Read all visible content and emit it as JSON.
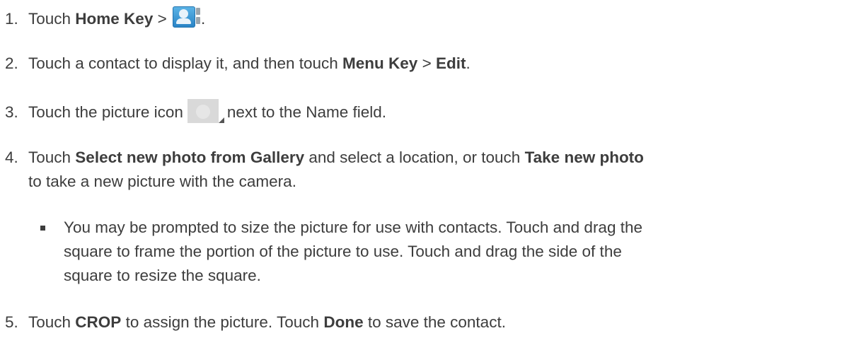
{
  "steps": [
    {
      "number": "1.",
      "text_before": "Touch ",
      "bold1": "Home Key",
      "text_mid": " > ",
      "icon": "contacts-app-icon",
      "text_after": "."
    },
    {
      "number": "2.",
      "text_before": "Touch a contact to display it, and then touch ",
      "bold1": "Menu Key",
      "text_mid": " > ",
      "bold2": "Edit",
      "text_after": "."
    },
    {
      "number": "3.",
      "text_before": "Touch the picture icon",
      "icon": "contact-picture-icon",
      "text_after": "next to the Name field."
    },
    {
      "number": "4.",
      "text_before": "Touch ",
      "bold1": "Select new photo from Gallery",
      "text_mid": " and select a location, or touch ",
      "bold2": "Take new photo",
      "line2": "to take a new picture with the camera."
    },
    {
      "number": "5.",
      "text_before": "Touch ",
      "bold1": "CROP",
      "text_mid": " to assign the picture. Touch ",
      "bold2": "Done",
      "text_after": " to save the contact."
    }
  ],
  "bullet": {
    "lines": [
      "You may be prompted to size the picture for use with contacts. Touch and drag the",
      "square to frame the portion of the picture to use. Touch and drag the side of the",
      "square to resize the square."
    ]
  }
}
